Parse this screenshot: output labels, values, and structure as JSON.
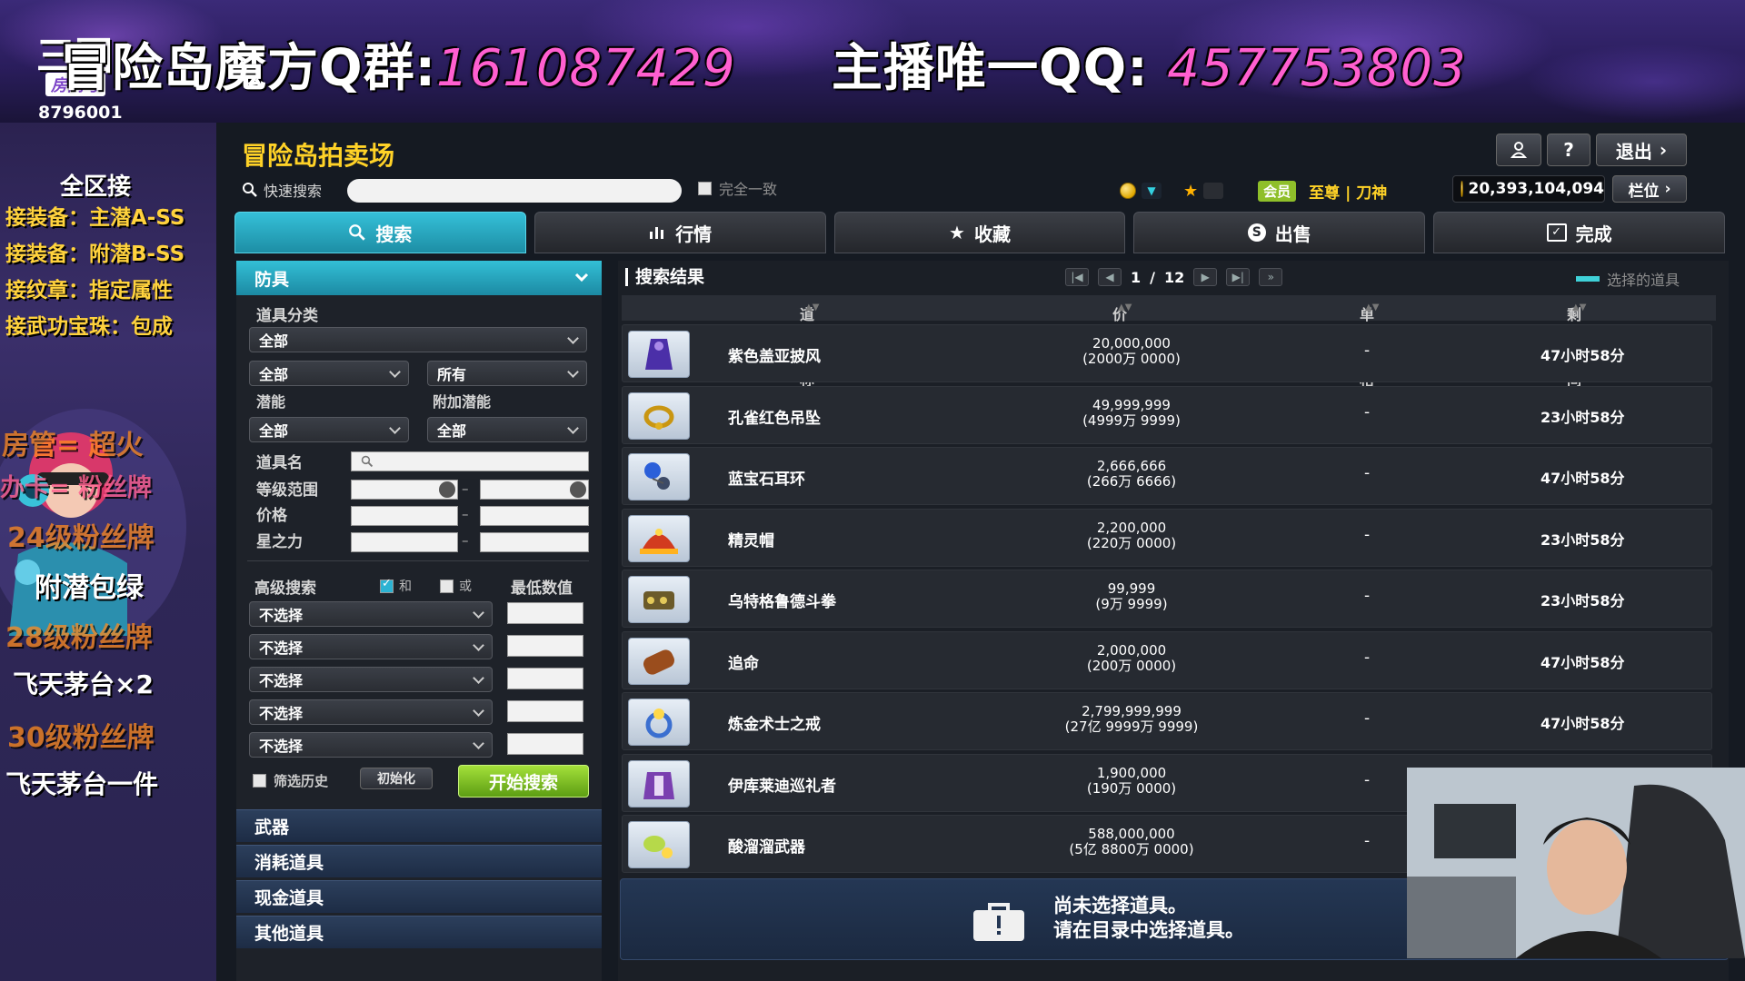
{
  "banner": {
    "group_label": "冒险岛魔方Q群:",
    "group_number": "161087429",
    "host_label": "主播唯一QQ:",
    "host_number": "457753803",
    "room_logo": "三国",
    "room_tag": "房间号",
    "room_number": "8796001"
  },
  "stream_sidebar": {
    "lines": [
      "全区接",
      "接装备：主潜A-SS",
      "接装备：附潜B-SS",
      "接纹章：指定属性",
      "接武功宝珠：包成"
    ],
    "admin": "房管= 超火",
    "card": "办卡= 粉丝牌",
    "promo": [
      "24级粉丝牌",
      "附潜包绿",
      "28级粉丝牌",
      "飞天茅台×2",
      "30级粉丝牌",
      "飞天茅台一件"
    ]
  },
  "window": {
    "title": "冒险岛拍卖场",
    "quick_search_label": "快速搜索",
    "quick_search_value": "",
    "exact_match_label": "完全一致",
    "exit_label": "退出",
    "help_label": "?",
    "vip_badge": "会员",
    "vip_tier": "至尊 | 刀神",
    "mesos": "20,393,104,094",
    "slot_label": "栏位"
  },
  "tabs": [
    {
      "label": "搜索",
      "icon": "search-icon"
    },
    {
      "label": "行情",
      "icon": "chart-icon"
    },
    {
      "label": "收藏",
      "icon": "star-icon"
    },
    {
      "label": "出售",
      "icon": "mesos-icon"
    },
    {
      "label": "完成",
      "icon": "check-icon"
    }
  ],
  "filter": {
    "category": "防具",
    "item_class_label": "道具分类",
    "item_class_value": "全部",
    "sub1": "全部",
    "sub2": "所有",
    "potential_label": "潜能",
    "bonus_potential_label": "附加潜能",
    "potential_value": "全部",
    "bonus_potential_value": "全部",
    "item_name_label": "道具名",
    "item_name_value": "",
    "level_label": "等级范围",
    "level_min": "",
    "level_max": "",
    "price_label": "价格",
    "price_min": "",
    "price_max": "",
    "star_label": "星之力",
    "star_min": "",
    "star_max": "",
    "advanced_label": "高级搜索",
    "and_label": "和",
    "or_label": "或",
    "min_value_label": "最低数值",
    "option_rows": [
      "不选择",
      "不选择",
      "不选择",
      "不选择",
      "不选择"
    ],
    "history_label": "筛选历史",
    "reset_label": "初始化",
    "search_label": "开始搜索",
    "categories": [
      "武器",
      "消耗道具",
      "现金道具",
      "其他道具"
    ]
  },
  "results": {
    "title": "搜索结果",
    "page_current": "1",
    "page_total": "12",
    "legend": "选择的道具",
    "columns": [
      "道具名称",
      "价格",
      "单个价格",
      "剩余时间"
    ],
    "rows": [
      {
        "name": "紫色盖亚披风",
        "price": "20,000,000",
        "price_cn": "(2000万 0000)",
        "unit": "-",
        "time": "47小时58分",
        "icon": "cape-icon"
      },
      {
        "name": "孔雀红色吊坠",
        "price": "49,999,999",
        "price_cn": "(4999万 9999)",
        "unit": "-",
        "time": "23小时58分",
        "icon": "pendant-icon"
      },
      {
        "name": "蓝宝石耳环",
        "price": "2,666,666",
        "price_cn": "(266万 6666)",
        "unit": "-",
        "time": "47小时58分",
        "icon": "earring-icon"
      },
      {
        "name": "精灵帽",
        "price": "2,200,000",
        "price_cn": "(220万 0000)",
        "unit": "-",
        "time": "23小时58分",
        "icon": "hat-icon"
      },
      {
        "name": "乌特格鲁德斗拳",
        "price": "99,999",
        "price_cn": "(9万 9999)",
        "unit": "-",
        "time": "23小时58分",
        "icon": "knuckle-icon"
      },
      {
        "name": "追命",
        "price": "2,000,000",
        "price_cn": "(200万 0000)",
        "unit": "-",
        "time": "47小时58分",
        "icon": "scroll-icon"
      },
      {
        "name": "炼金术士之戒",
        "price": "2,799,999,999",
        "price_cn": "(27亿 9999万 9999)",
        "unit": "-",
        "time": "47小时58分",
        "icon": "ring-icon"
      },
      {
        "name": "伊库莱迪巡礼者",
        "price": "1,900,000",
        "price_cn": "(190万 0000)",
        "unit": "-",
        "time": "",
        "icon": "armor-icon"
      },
      {
        "name": "酸溜溜武器",
        "price": "588,000,000",
        "price_cn": "(5亿 8800万 0000)",
        "unit": "-",
        "time": "",
        "icon": "weapon-icon"
      }
    ],
    "notice_line1": "尚未选择道具。",
    "notice_line2": "请在目录中选择道具。"
  },
  "colors": {
    "accent": "#2bb3d3",
    "title": "#ffd227",
    "go_button": "#7cc224",
    "banner_pink": "#ff5fd0"
  }
}
